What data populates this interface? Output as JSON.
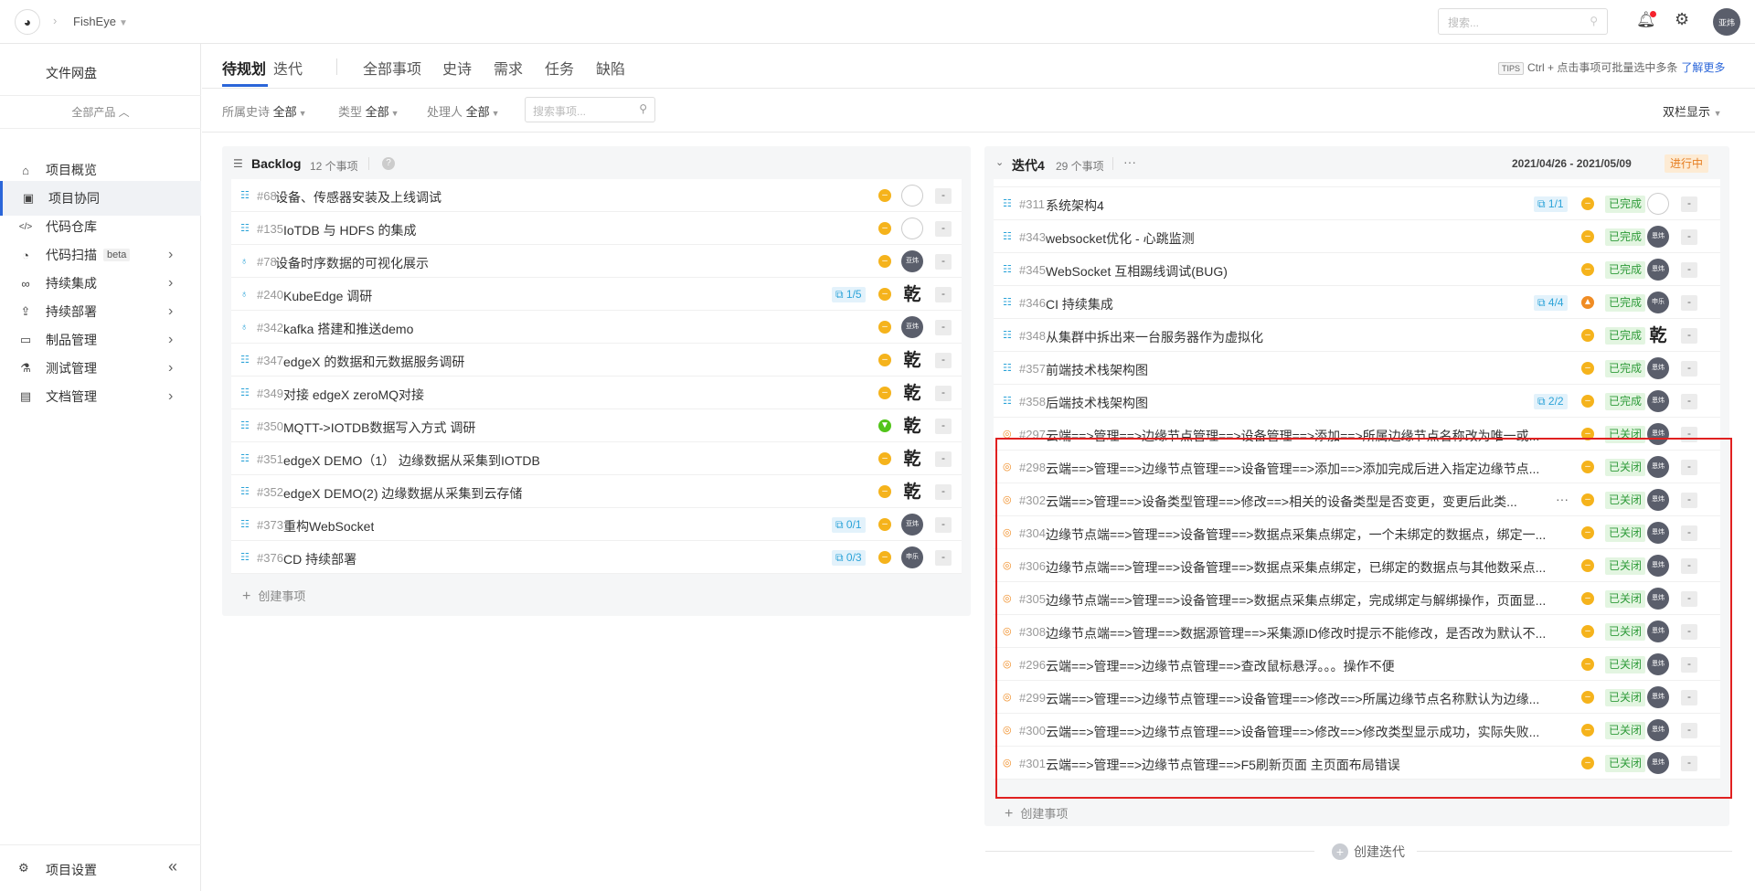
{
  "topbar": {
    "project_name": "FishEye",
    "search_placeholder": "搜索...",
    "user_initials": "亚炜"
  },
  "sidebar": {
    "files": "文件网盘",
    "all_products": "全部产品",
    "items": [
      {
        "label": "项目概览",
        "icon": "home-icon"
      },
      {
        "label": "项目协同",
        "icon": "board-icon",
        "active": true
      },
      {
        "label": "代码仓库",
        "icon": "code-icon"
      },
      {
        "label": "代码扫描",
        "icon": "scan-icon",
        "badge": "beta",
        "arrow": true
      },
      {
        "label": "持续集成",
        "icon": "infinity-icon",
        "arrow": true
      },
      {
        "label": "持续部署",
        "icon": "deploy-icon",
        "arrow": true
      },
      {
        "label": "制品管理",
        "icon": "artifact-icon",
        "arrow": true
      },
      {
        "label": "测试管理",
        "icon": "flask-icon",
        "arrow": true
      },
      {
        "label": "文档管理",
        "icon": "document-icon",
        "arrow": true
      }
    ],
    "settings": "项目设置"
  },
  "tabs": {
    "items": [
      "待规划",
      "迭代",
      "全部事项",
      "史诗",
      "需求",
      "任务",
      "缺陷"
    ],
    "tips_tag": "TIPS",
    "tips_text": "Ctrl + 点击事项可批量选中多条",
    "tips_link": "了解更多"
  },
  "filters": {
    "epic_label": "所属史诗",
    "epic_value": "全部",
    "type_label": "类型",
    "type_value": "全部",
    "assignee_label": "处理人",
    "assignee_value": "全部",
    "search_placeholder": "搜索事项...",
    "view_mode": "双栏显示"
  },
  "backlog": {
    "title": "Backlog",
    "count": "12 个事项",
    "create_label": "创建事项",
    "rows": [
      {
        "type": "task",
        "num": "#68",
        "title": "设备、传感器安装及上线调试",
        "sub": "",
        "prio": "yellow",
        "avatar": "empty",
        "av_text": ""
      },
      {
        "type": "task",
        "num": "#135",
        "title": "IoTDB 与 HDFS 的集成",
        "sub": "",
        "prio": "yellow",
        "avatar": "empty",
        "av_text": ""
      },
      {
        "type": "idea",
        "num": "#78",
        "title": "设备时序数据的可视化展示",
        "sub": "",
        "prio": "yellow",
        "avatar": "dark",
        "av_text": "亚炜"
      },
      {
        "type": "idea",
        "num": "#240",
        "title": "KubeEdge 调研",
        "sub": "1/5",
        "prio": "yellow",
        "avatar": "calli",
        "av_text": "乾"
      },
      {
        "type": "idea",
        "num": "#342",
        "title": "kafka 搭建和推送demo",
        "sub": "",
        "prio": "yellow",
        "avatar": "dark",
        "av_text": "亚炜"
      },
      {
        "type": "task",
        "num": "#347",
        "title": "edgeX 的数据和元数据服务调研",
        "sub": "",
        "prio": "yellow",
        "avatar": "calli",
        "av_text": "乾"
      },
      {
        "type": "task",
        "num": "#349",
        "title": "对接 edgeX zeroMQ对接",
        "sub": "",
        "prio": "yellow",
        "avatar": "calli",
        "av_text": "乾"
      },
      {
        "type": "task",
        "num": "#350",
        "title": "MQTT->IOTDB数据写入方式 调研",
        "sub": "",
        "prio": "green",
        "avatar": "calli",
        "av_text": "乾"
      },
      {
        "type": "task",
        "num": "#351",
        "title": "edgeX DEMO（1） 边缘数据从采集到IOTDB",
        "sub": "",
        "prio": "yellow",
        "avatar": "calli",
        "av_text": "乾"
      },
      {
        "type": "task",
        "num": "#352",
        "title": "edgeX DEMO(2) 边缘数据从采集到云存储",
        "sub": "",
        "prio": "yellow",
        "avatar": "calli",
        "av_text": "乾"
      },
      {
        "type": "task",
        "num": "#373",
        "title": "重构WebSocket",
        "sub": "0/1",
        "prio": "yellow",
        "avatar": "dark",
        "av_text": "亚炜"
      },
      {
        "type": "task",
        "num": "#376",
        "title": "CD 持续部署",
        "sub": "0/3",
        "prio": "yellow",
        "avatar": "dark",
        "av_text": "申乐"
      }
    ]
  },
  "iteration": {
    "title": "迭代4",
    "count": "29 个事项",
    "date_range": "2021/04/26 - 2021/05/09",
    "state": "进行中",
    "create_label": "创建事项",
    "rows": [
      {
        "type": "task",
        "num": "#311",
        "title": "系统架构4",
        "sub": "1/1",
        "prio": "yellow",
        "status": "已完成",
        "avatar": "empty",
        "av_text": ""
      },
      {
        "type": "task",
        "num": "#343",
        "title": "websocket优化 - 心跳监测",
        "sub": "",
        "prio": "yellow",
        "status": "已完成",
        "avatar": "dark",
        "av_text": "恩炜"
      },
      {
        "type": "task",
        "num": "#345",
        "title": "WebSocket 互相踢线调试(BUG)",
        "sub": "",
        "prio": "yellow",
        "status": "已完成",
        "avatar": "dark",
        "av_text": "恩炜"
      },
      {
        "type": "task",
        "num": "#346",
        "title": "CI 持续集成",
        "sub": "4/4",
        "prio": "orange",
        "status": "已完成",
        "avatar": "dark",
        "av_text": "申乐"
      },
      {
        "type": "task",
        "num": "#348",
        "title": "从集群中拆出来一台服务器作为虚拟化",
        "sub": "",
        "prio": "yellow",
        "status": "已完成",
        "avatar": "calli",
        "av_text": "乾"
      },
      {
        "type": "task",
        "num": "#357",
        "title": "前端技术栈架构图",
        "sub": "",
        "prio": "yellow",
        "status": "已完成",
        "avatar": "dark",
        "av_text": "恩炜"
      },
      {
        "type": "task",
        "num": "#358",
        "title": "后端技术栈架构图",
        "sub": "2/2",
        "prio": "yellow",
        "status": "已完成",
        "avatar": "dark",
        "av_text": "恩炜"
      },
      {
        "type": "bug",
        "num": "#297",
        "title": "云端==>管理==>边缘节点管理==>设备管理==>添加==>所属边缘节点名称改为唯一或...",
        "sub": "",
        "prio": "yellow",
        "status": "已关闭",
        "avatar": "dark",
        "av_text": "恩炜"
      },
      {
        "type": "bug",
        "num": "#298",
        "title": "云端==>管理==>边缘节点管理==>设备管理==>添加==>添加完成后进入指定边缘节点...",
        "sub": "",
        "prio": "yellow",
        "status": "已关闭",
        "avatar": "dark",
        "av_text": "恩炜"
      },
      {
        "type": "bug",
        "num": "#302",
        "title": "云端==>管理==>设备类型管理==>修改==>相关的设备类型是否变更，变更后此类...",
        "sub": "",
        "prio": "yellow",
        "status": "已关闭",
        "avatar": "dark",
        "av_text": "恩炜",
        "dots": true
      },
      {
        "type": "bug",
        "num": "#304",
        "title": "边缘节点端==>管理==>设备管理==>数据点采集点绑定，一个未绑定的数据点，绑定一...",
        "sub": "",
        "prio": "yellow",
        "status": "已关闭",
        "avatar": "dark",
        "av_text": "恩炜"
      },
      {
        "type": "bug",
        "num": "#306",
        "title": "边缘节点端==>管理==>设备管理==>数据点采集点绑定，已绑定的数据点与其他数采点...",
        "sub": "",
        "prio": "yellow",
        "status": "已关闭",
        "avatar": "dark",
        "av_text": "恩炜"
      },
      {
        "type": "bug",
        "num": "#305",
        "title": "边缘节点端==>管理==>设备管理==>数据点采集点绑定，完成绑定与解绑操作，页面显...",
        "sub": "",
        "prio": "yellow",
        "status": "已关闭",
        "avatar": "dark",
        "av_text": "恩炜"
      },
      {
        "type": "bug",
        "num": "#308",
        "title": "边缘节点端==>管理==>数据源管理==>采集源ID修改时提示不能修改，是否改为默认不...",
        "sub": "",
        "prio": "yellow",
        "status": "已关闭",
        "avatar": "dark",
        "av_text": "恩炜"
      },
      {
        "type": "bug",
        "num": "#296",
        "title": "云端==>管理==>边缘节点管理==>查改鼠标悬浮。。。操作不便",
        "sub": "",
        "prio": "yellow",
        "status": "已关闭",
        "avatar": "dark",
        "av_text": "恩炜"
      },
      {
        "type": "bug",
        "num": "#299",
        "title": "云端==>管理==>边缘节点管理==>设备管理==>修改==>所属边缘节点名称默认为边缘...",
        "sub": "",
        "prio": "yellow",
        "status": "已关闭",
        "avatar": "dark",
        "av_text": "恩炜"
      },
      {
        "type": "bug",
        "num": "#300",
        "title": "云端==>管理==>边缘节点管理==>设备管理==>修改==>修改类型显示成功，实际失败...",
        "sub": "",
        "prio": "yellow",
        "status": "已关闭",
        "avatar": "dark",
        "av_text": "恩炜"
      },
      {
        "type": "bug",
        "num": "#301",
        "title": "云端==>管理==>边缘节点管理==>F5刷新页面 主页面布局错误",
        "sub": "",
        "prio": "yellow",
        "status": "已关闭",
        "avatar": "dark",
        "av_text": "恩炜"
      }
    ]
  },
  "create_iteration": "创建迭代",
  "colors": {
    "accent": "#2b66d9",
    "done_bg": "#e3f5e1",
    "done_fg": "#2f9b3a",
    "priority": "#f5b31c",
    "highlight": "#e02020"
  }
}
